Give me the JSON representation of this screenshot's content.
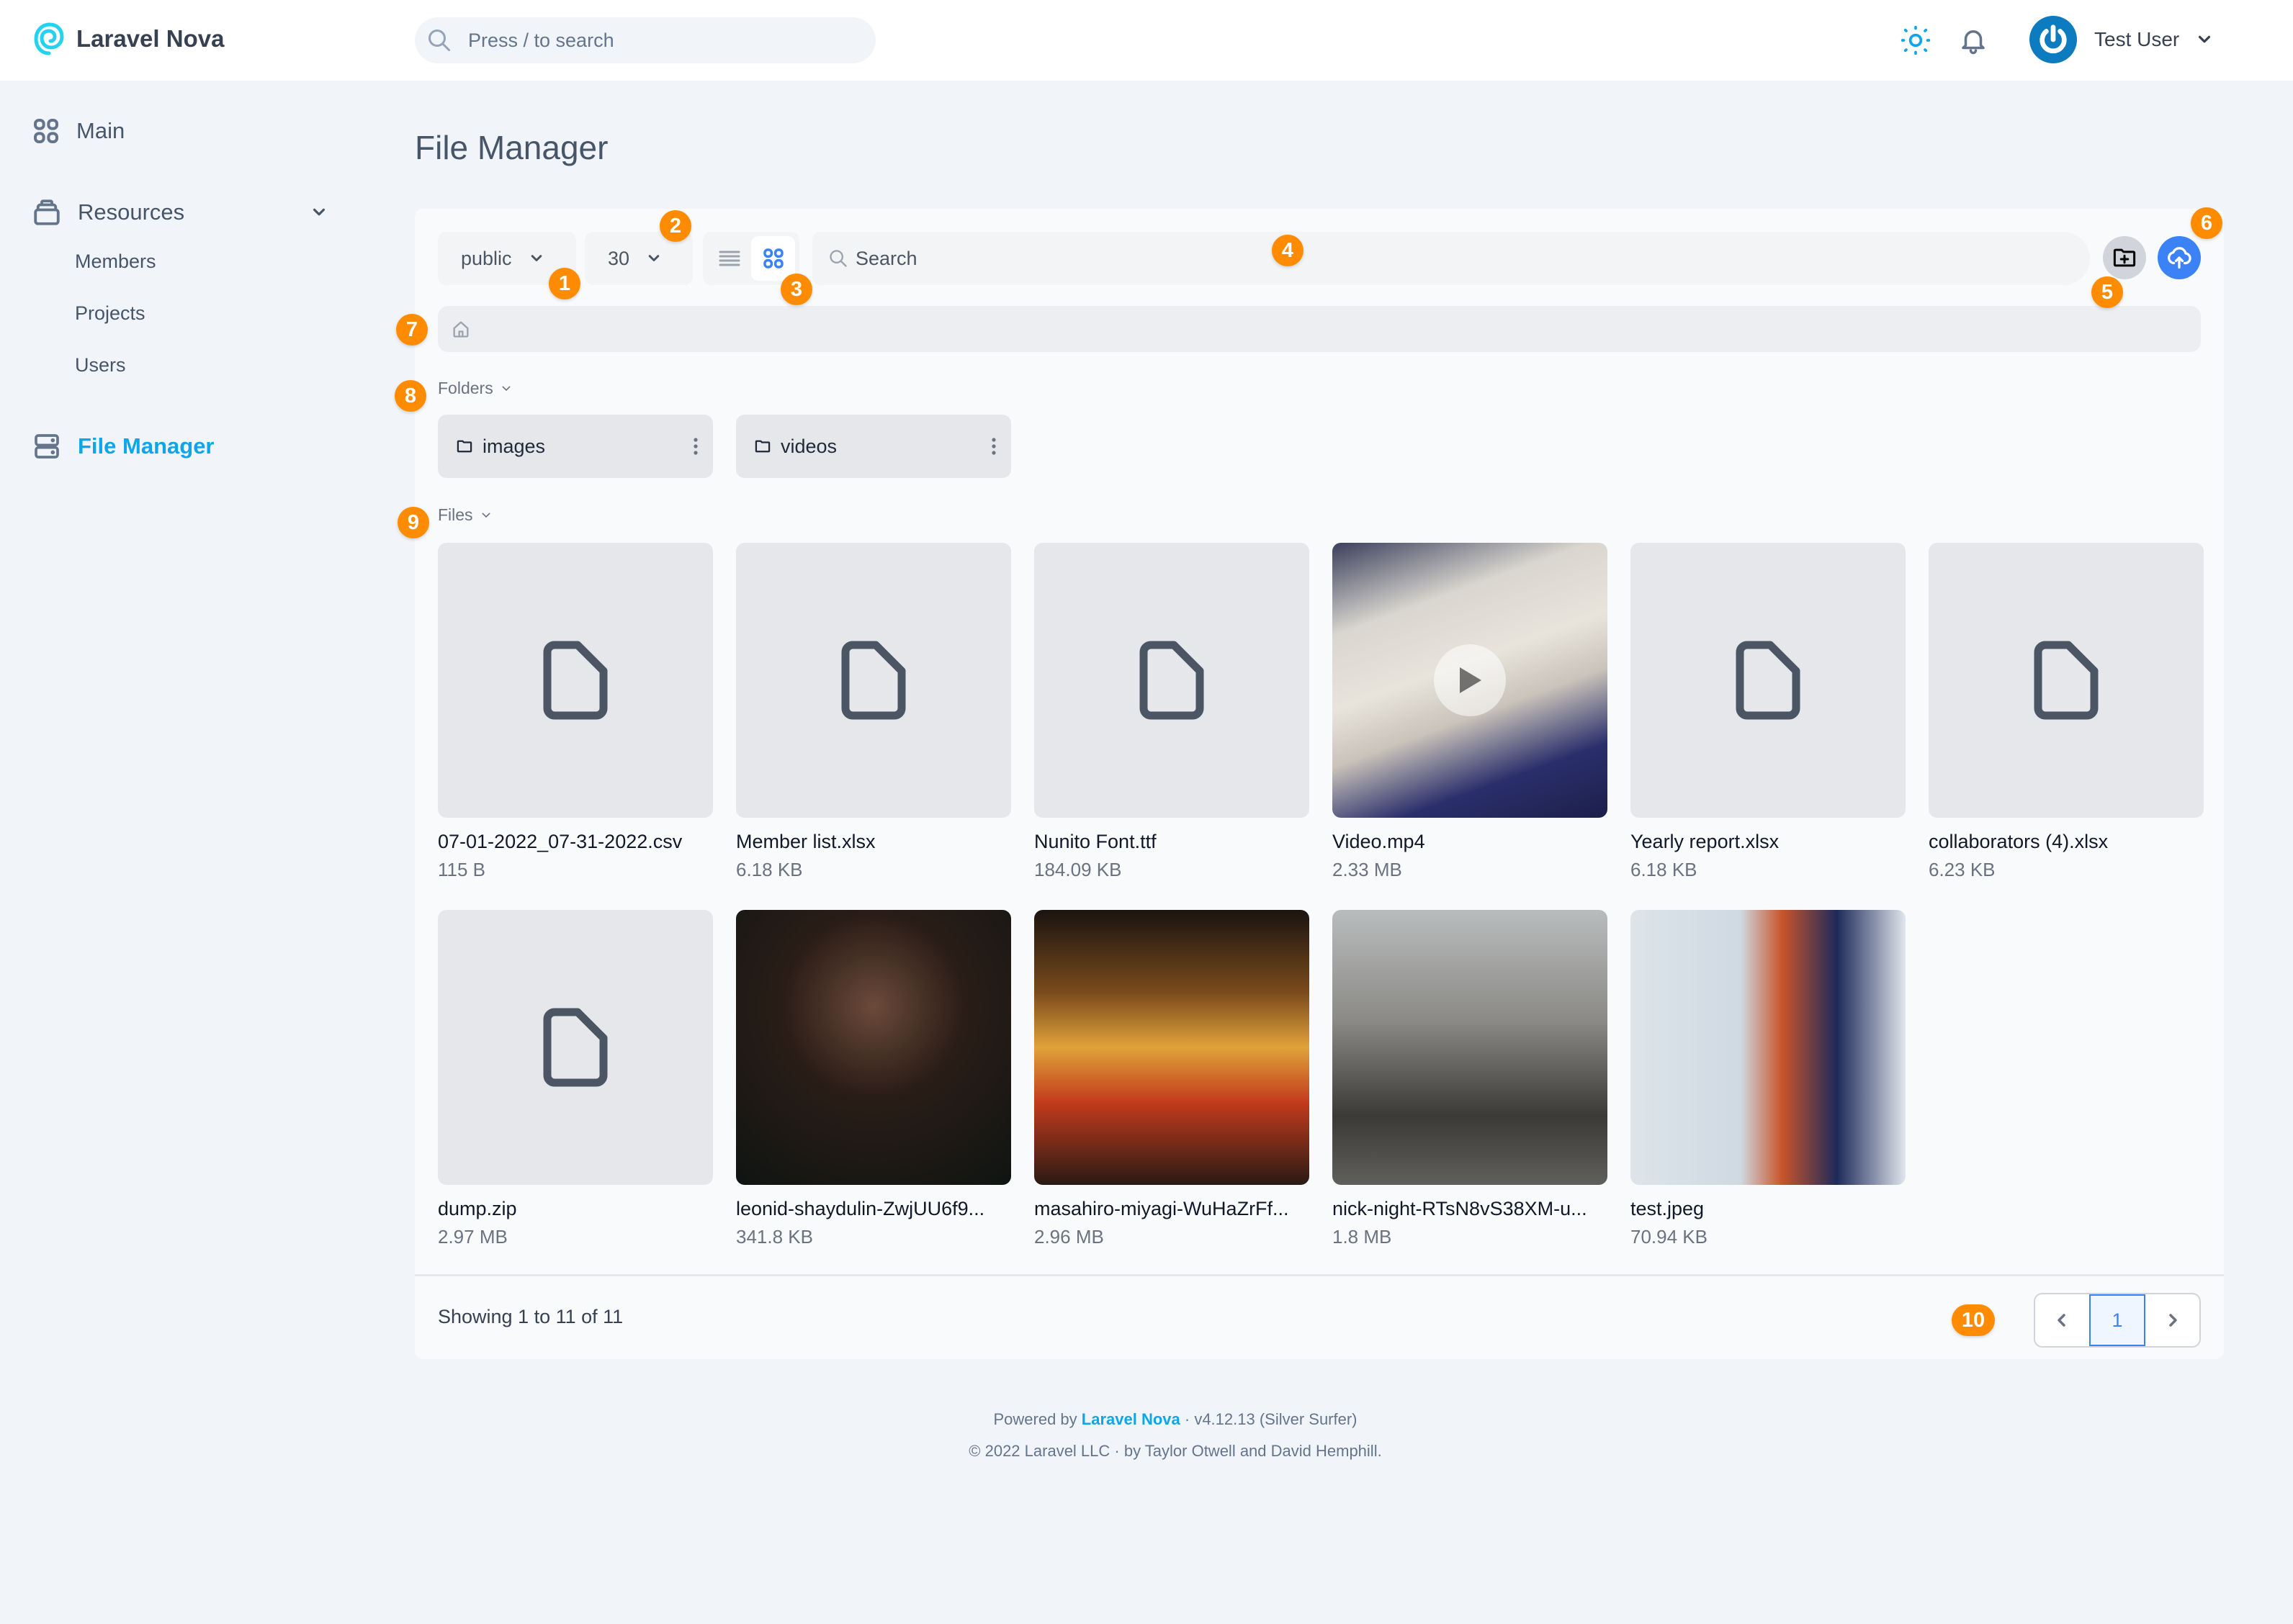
{
  "app": {
    "name": "Laravel Nova"
  },
  "header": {
    "search_placeholder": "Press / to search",
    "user_name": "Test User"
  },
  "sidebar": {
    "items": [
      {
        "label": "Main",
        "icon": "grid-icon"
      },
      {
        "label": "Resources",
        "icon": "archive-icon",
        "expanded": true,
        "children": [
          {
            "label": "Members"
          },
          {
            "label": "Projects"
          },
          {
            "label": "Users"
          }
        ]
      },
      {
        "label": "File Manager",
        "icon": "server-icon",
        "active": true
      }
    ]
  },
  "page": {
    "title": "File Manager"
  },
  "toolbar": {
    "disk": "public",
    "per_page": "30",
    "view_mode": "grid",
    "search_placeholder": "Search"
  },
  "annotations": [
    "1",
    "2",
    "3",
    "4",
    "5",
    "6",
    "7",
    "8",
    "9",
    "10"
  ],
  "sections": {
    "folders_label": "Folders",
    "files_label": "Files"
  },
  "folders": [
    {
      "name": "images"
    },
    {
      "name": "videos"
    }
  ],
  "files": [
    {
      "name": "07-01-2022_07-31-2022.csv",
      "size": "115 B",
      "type": "generic"
    },
    {
      "name": "Member list.xlsx",
      "size": "6.18 KB",
      "type": "generic"
    },
    {
      "name": "Nunito Font.ttf",
      "size": "184.09 KB",
      "type": "generic"
    },
    {
      "name": "Video.mp4",
      "size": "2.33 MB",
      "type": "video"
    },
    {
      "name": "Yearly report.xlsx",
      "size": "6.18 KB",
      "type": "generic"
    },
    {
      "name": "collaborators (4).xlsx",
      "size": "6.23 KB",
      "type": "generic"
    },
    {
      "name": "dump.zip",
      "size": "2.97 MB",
      "type": "generic"
    },
    {
      "name": "leonid-shaydulin-ZwjUU6f9...",
      "size": "341.8 KB",
      "type": "image"
    },
    {
      "name": "masahiro-miyagi-WuHaZrFf...",
      "size": "2.96 MB",
      "type": "image"
    },
    {
      "name": "nick-night-RTsN8vS38XM-u...",
      "size": "1.8 MB",
      "type": "image"
    },
    {
      "name": "test.jpeg",
      "size": "70.94 KB",
      "type": "image"
    }
  ],
  "pagination": {
    "showing": "Showing 1 to 11 of 11",
    "current_page": "1",
    "prev": "‹",
    "next": "›"
  },
  "footer": {
    "powered_prefix": "Powered by",
    "powered_link": "Laravel Nova",
    "version": "· v4.12.13 (Silver Surfer)",
    "copyright": "© 2022 Laravel LLC · by Taylor Otwell and David Hemphill."
  },
  "colors": {
    "accent": "#0ea5e9",
    "primary_button": "#3b82f6",
    "annotation": "#ff8c00"
  }
}
